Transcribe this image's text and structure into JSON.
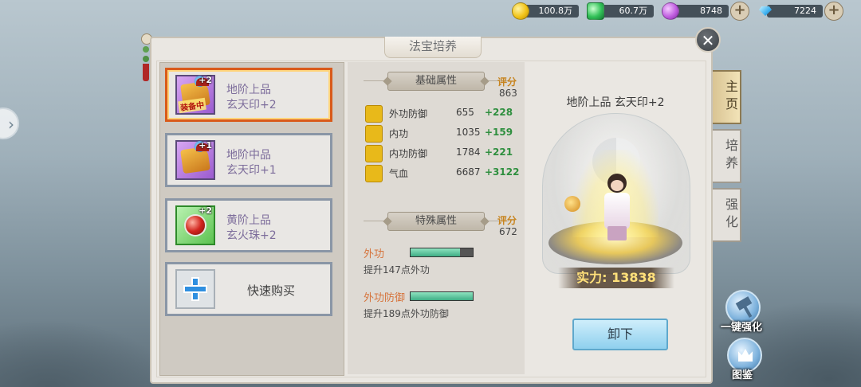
{
  "currency": [
    {
      "icon": "gold-coin-icon",
      "value": "100.8万"
    },
    {
      "icon": "jade-icon",
      "value": "60.7万"
    },
    {
      "icon": "purple-gem-icon",
      "value": "8748"
    },
    {
      "icon": "diamond-icon",
      "value": "7224"
    }
  ],
  "panel": {
    "title": "法宝培养"
  },
  "list": {
    "items": [
      {
        "grade": "地阶上品",
        "name": "玄天印+2",
        "level": "+2",
        "tag": "装备中",
        "selected": true
      },
      {
        "grade": "地阶中品",
        "name": "玄天印+1",
        "level": "+1"
      },
      {
        "grade": "黄阶上品",
        "name": "玄火珠+2",
        "level": "+2"
      }
    ],
    "quick_buy": "快速购买"
  },
  "basic": {
    "title": "基础属性",
    "score_label": "评分",
    "score": "863",
    "stats": [
      {
        "name": "外功防御",
        "value": "655",
        "add": "+228"
      },
      {
        "name": "内功",
        "value": "1035",
        "add": "+159"
      },
      {
        "name": "内功防御",
        "value": "1784",
        "add": "+221"
      },
      {
        "name": "气血",
        "value": "6687",
        "add": "+3122"
      }
    ]
  },
  "special": {
    "title": "特殊属性",
    "score_label": "评分",
    "score": "672",
    "attrs": [
      {
        "name": "外功",
        "desc": "提升147点外功",
        "progress": 0.8
      },
      {
        "name": "外功防御",
        "desc": "提升189点外功防御",
        "progress": 1.0
      }
    ]
  },
  "display": {
    "item_title": "地阶上品 玄天印+2",
    "power": "实力: 13838",
    "unequip": "卸下"
  },
  "tabs": [
    {
      "label": "主页",
      "active": true
    },
    {
      "label": "培养",
      "active": false
    },
    {
      "label": "强化",
      "active": false
    }
  ],
  "buttons": {
    "one_key": "一键强化",
    "codex": "图鉴"
  },
  "colors": {
    "accent": "#d95a1a",
    "bonus": "#2f8f3f",
    "score": "#c7841f"
  }
}
